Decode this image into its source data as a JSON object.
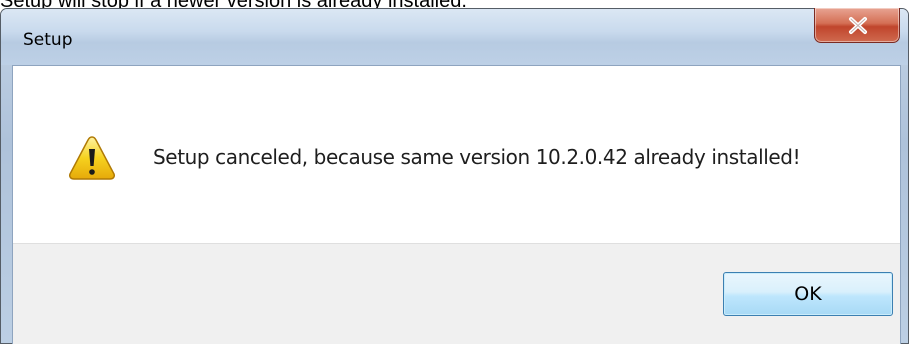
{
  "background_caption": "Setup will stop if a newer version is already installed.",
  "dialog": {
    "title": "Setup",
    "close_icon": "close-x-icon",
    "message": "Setup canceled, because same version 10.2.0.42 already installed!",
    "icon": "warning-icon",
    "ok_label": "OK"
  },
  "colors": {
    "close_button": "#c0452c",
    "warning_yellow": "#f6c90e",
    "button_face": "#bee6fd",
    "button_border": "#3c7fb1",
    "footer_background": "#f0f0f0"
  }
}
